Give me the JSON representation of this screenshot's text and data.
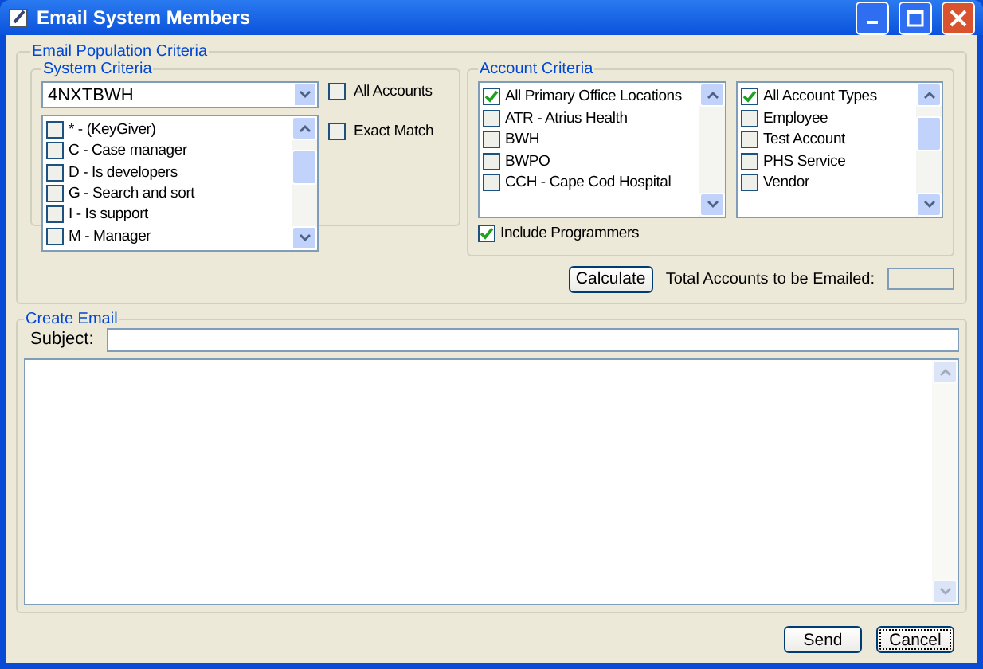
{
  "window": {
    "title": "Email System Members"
  },
  "population": {
    "title": "Email Population Criteria",
    "system_criteria": {
      "title": "System Criteria",
      "dropdown": "4NXTBWH",
      "items": [
        {
          "label": "* - (KeyGiver)",
          "checked": false
        },
        {
          "label": "C - Case manager",
          "checked": false
        },
        {
          "label": "D - Is developers",
          "checked": false
        },
        {
          "label": "G - Search and sort",
          "checked": false
        },
        {
          "label": "I - Is support",
          "checked": false
        },
        {
          "label": "M - Manager",
          "checked": false
        }
      ],
      "options": [
        {
          "label": "All Accounts",
          "checked": false
        },
        {
          "label": "Exact Match",
          "checked": false
        }
      ]
    },
    "account_criteria": {
      "title": "Account Criteria",
      "locations": [
        {
          "label": "All Primary Office Locations",
          "checked": true
        },
        {
          "label": "ATR - Atrius Health",
          "checked": false
        },
        {
          "label": "BWH",
          "checked": false
        },
        {
          "label": "BWPO",
          "checked": false
        },
        {
          "label": "CCH - Cape Cod Hospital",
          "checked": false
        }
      ],
      "types": [
        {
          "label": "All Account Types",
          "checked": true
        },
        {
          "label": "Employee",
          "checked": false
        },
        {
          "label": "Test Account",
          "checked": false
        },
        {
          "label": "PHS Service",
          "checked": false
        },
        {
          "label": "Vendor",
          "checked": false
        }
      ],
      "include_programmers": {
        "label": "Include Programmers",
        "checked": true
      }
    },
    "calculate": "Calculate",
    "total_label": "Total Accounts to be Emailed:"
  },
  "create_email": {
    "title": "Create Email",
    "subject_label": "Subject:"
  },
  "buttons": [
    {
      "label": "Send",
      "focused": false
    },
    {
      "label": "Cancel",
      "focused": true
    }
  ]
}
